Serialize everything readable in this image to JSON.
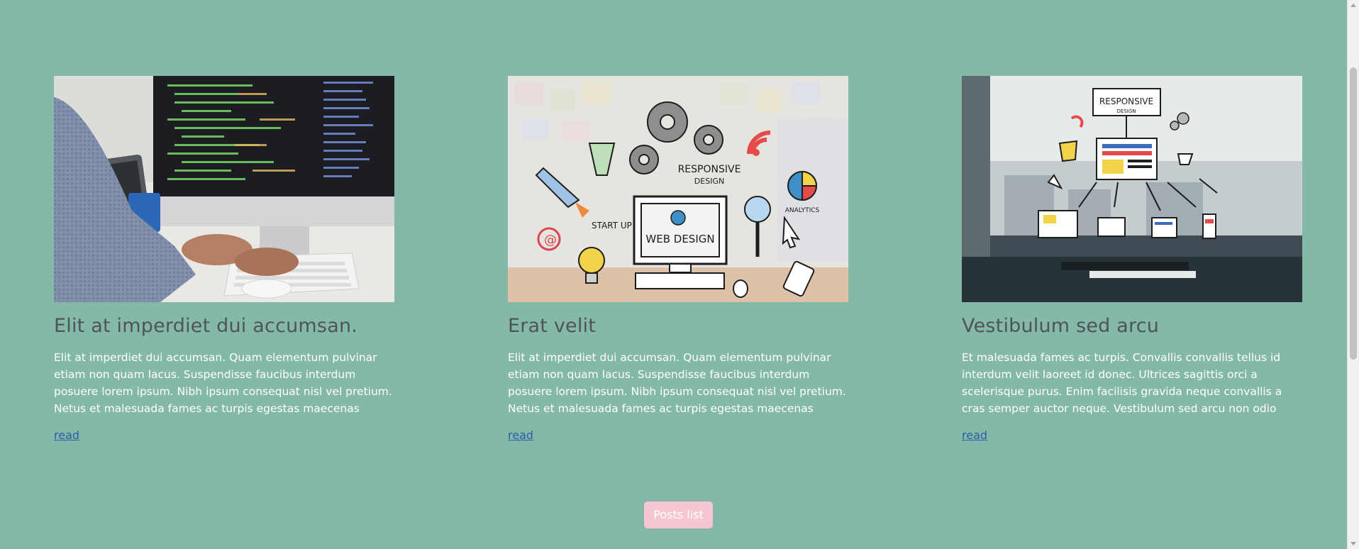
{
  "posts": [
    {
      "image_alt": "person typing on computer with code on screen",
      "title": "Elit at imperdiet dui accumsan.",
      "excerpt": "Elit at imperdiet dui accumsan. Quam elementum pulvinar etiam non quam lacus. Suspendisse faucibus interdum posuere lorem ipsum. Nibh ipsum consequat nisl vel pretium. Netus et malesuada fames ac turpis egestas maecenas pharetra. Malesuada…",
      "link": "read"
    },
    {
      "image_alt": "responsive web design doodle illustration",
      "title": "Erat velit",
      "excerpt": "Elit at imperdiet dui accumsan. Quam elementum pulvinar etiam non quam lacus. Suspendisse faucibus interdum posuere lorem ipsum. Nibh ipsum consequat nisl vel pretium. Netus et malesuada fames ac turpis egestas maecenas pharetra. Malesuada…",
      "link": "read",
      "image_text": {
        "responsive": "RESPONSIVE",
        "design": "DESIGN",
        "web_design": "WEB DESIGN",
        "start_up": "START UP",
        "analytics": "ANALYTICS"
      }
    },
    {
      "image_alt": "responsive design sketch over office desk",
      "title": "Vestibulum sed arcu",
      "excerpt": "Et malesuada fames ac turpis. Convallis convallis tellus id interdum velit laoreet id donec. Ultrices sagittis orci a scelerisque purus. Enim facilisis gravida neque convallis a cras semper auctor neque. Vestibulum sed arcu non odio euismod. Hac habitasse…",
      "link": "read",
      "image_text": {
        "responsive": "RESPONSIVE",
        "design": "DESIGN"
      }
    }
  ],
  "posts_list_button": "Posts list",
  "colors": {
    "background": "#84b8a8",
    "title": "#4f5456",
    "excerpt": "#ffffff",
    "link": "#2a5ea8",
    "button_bg": "#f6c7d2"
  }
}
